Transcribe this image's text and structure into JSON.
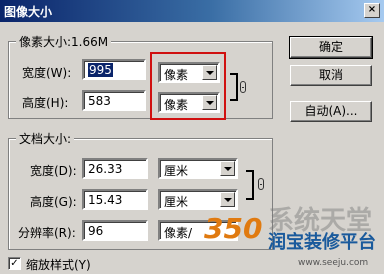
{
  "window": {
    "title": "图像大小",
    "close_glyph": "×"
  },
  "pixel_dims": {
    "group_title": "像素大小:1.66M",
    "width_label": "宽度(W):",
    "width_value": "995",
    "width_unit": "像素",
    "height_label": "高度(H):",
    "height_value": "583",
    "height_unit": "像素"
  },
  "doc_size": {
    "group_title": "文档大小:",
    "width_label": "宽度(D):",
    "width_value": "26.33",
    "width_unit": "厘米",
    "height_label": "高度(G):",
    "height_value": "15.43",
    "height_unit": "厘米",
    "res_label": "分辨率(R):",
    "res_value": "96",
    "res_unit": "像素/"
  },
  "buttons": {
    "ok": "确定",
    "cancel": "取消",
    "auto": "自动(A)..."
  },
  "options": {
    "scale_styles_label": "缩放样式(Y)",
    "scale_styles_checked": "✓"
  },
  "watermark": {
    "big": "系统天堂",
    "logo": "350",
    "sub": "润宝装修平台",
    "url": "www.seeju.com"
  },
  "colors": {
    "highlight": "#d01010",
    "titlebar": "#0a246a",
    "accent_text": "#1a5a9c"
  }
}
